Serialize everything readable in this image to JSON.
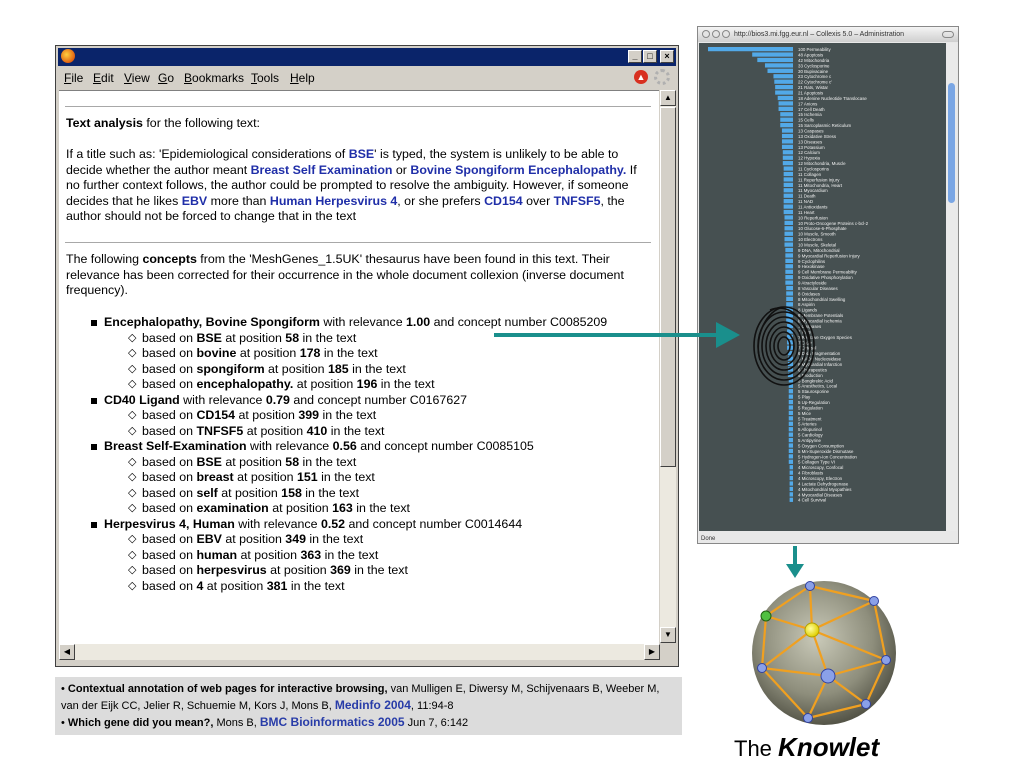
{
  "menu": [
    "File",
    "Edit",
    "View",
    "Go",
    "Bookmarks",
    "Tools",
    "Help"
  ],
  "window_buttons": [
    "_",
    "□",
    "×"
  ],
  "intro": {
    "heading_bold": "Text analysis",
    "heading_rest": " for the following text:",
    "p1": "If a title such as: 'Epidemiological considerations of ",
    "p1_bse": "BSE",
    "p2": "' is typed, the system is unlikely to be able to decide whether the author meant ",
    "p2_bse_long": "Breast Self Examination",
    "p3": " or ",
    "p3_bovine": "Bovine Spongiform Encephalopathy.",
    "p4": " If no further context follows, the author could be prompted to resolve the ambiguity. However, if someone decides that he likes ",
    "p4_ebv": "EBV",
    "p5": " more than ",
    "p5_herpes": "Human Herpesvirus 4",
    "p6": ", or she prefers ",
    "p6_cd154": "CD154",
    "p7": " over ",
    "p7_tnfsf5": "TNFSF5",
    "p8": ", the author should not be forced to change that in the text"
  },
  "concepts_intro": {
    "a": "The following ",
    "b": "concepts",
    "c": " from the 'MeshGenes_1.5UK' thesaurus have been found in this text. Their relevance has been corrected for their occurrence in the whole document collexion (inverse document frequency)."
  },
  "concepts": [
    {
      "name": "Encephalopathy, Bovine Spongiform",
      "relevance": "1.00",
      "number": "C0085209",
      "evidence": [
        {
          "term": "BSE",
          "position": "58"
        },
        {
          "term": "bovine",
          "position": "178"
        },
        {
          "term": "spongiform",
          "position": "185"
        },
        {
          "term": "encephalopathy.",
          "position": "196"
        }
      ]
    },
    {
      "name": "CD40 Ligand",
      "relevance": "0.79",
      "number": "C0167627",
      "evidence": [
        {
          "term": "CD154",
          "position": "399"
        },
        {
          "term": "TNFSF5",
          "position": "410"
        }
      ]
    },
    {
      "name": "Breast Self-Examination",
      "relevance": "0.56",
      "number": "C0085105",
      "evidence": [
        {
          "term": "BSE",
          "position": "58"
        },
        {
          "term": "breast",
          "position": "151"
        },
        {
          "term": "self",
          "position": "158"
        },
        {
          "term": "examination",
          "position": "163"
        }
      ]
    },
    {
      "name": "Herpesvirus 4, Human",
      "relevance": "0.52",
      "number": "C0014644",
      "evidence": [
        {
          "term": "EBV",
          "position": "349"
        },
        {
          "term": "human",
          "position": "363"
        },
        {
          "term": "herpesvirus",
          "position": "369"
        },
        {
          "term": "4",
          "position": "381"
        }
      ]
    }
  ],
  "phrases": {
    "with_relevance": " with relevance ",
    "and_concept": " and concept number ",
    "based_on": "based on ",
    "at_position": " at position ",
    "in_text": " in the text"
  },
  "references": {
    "r1_title": "Contextual annotation of web pages for interactive browsing,",
    "r1_authors": " van Mulligen E, Diwersy M, Schijvenaars B, Weeber M, van der Eijk CC, Jelier R, Schuemie M, Kors J, Mons B, ",
    "r1_venue": "Medinfo 2004",
    "r1_pages": ", 11:94-8",
    "r2_title": "Which gene did you mean?,",
    "r2_authors": " Mons B, ",
    "r2_venue": "BMC Bioinformatics 2005",
    "r2_pages": " Jun 7, 6:142"
  },
  "collexis": {
    "title": "http://bios3.mi.fgg.eur.nl – Collexis 5.0 – Administration",
    "status": "Done",
    "items": [
      {
        "v": 100,
        "label": "Permeability"
      },
      {
        "v": 48,
        "label": "Apoptosis"
      },
      {
        "v": 42,
        "label": "Mitochondria"
      },
      {
        "v": 33,
        "label": "Cyclosporine"
      },
      {
        "v": 30,
        "label": "Bupivacaine"
      },
      {
        "v": 23,
        "label": "Cytochrome c"
      },
      {
        "v": 22,
        "label": "Cytochrome c'"
      },
      {
        "v": 21,
        "label": "Rats, Wistar"
      },
      {
        "v": 21,
        "label": "Apoptosis"
      },
      {
        "v": 18,
        "label": "Adenine Nucleotide Translocase"
      },
      {
        "v": 17,
        "label": "Anions"
      },
      {
        "v": 17,
        "label": "Cell Death"
      },
      {
        "v": 15,
        "label": "Ischemia"
      },
      {
        "v": 15,
        "label": "Cells"
      },
      {
        "v": 15,
        "label": "Sarcoplasmic Reticulum"
      },
      {
        "v": 13,
        "label": "Caspases"
      },
      {
        "v": 13,
        "label": "Oxidative Stress"
      },
      {
        "v": 13,
        "label": "Diseases"
      },
      {
        "v": 13,
        "label": "Potassium"
      },
      {
        "v": 12,
        "label": "Calcium"
      },
      {
        "v": 12,
        "label": "Hypoxia"
      },
      {
        "v": 12,
        "label": "Mitochondria, Muscle"
      },
      {
        "v": 11,
        "label": "Cyclosporins"
      },
      {
        "v": 11,
        "label": "Collagen"
      },
      {
        "v": 11,
        "label": "Reperfusion Injury"
      },
      {
        "v": 11,
        "label": "Mitochondria, Heart"
      },
      {
        "v": 11,
        "label": "Myocardium"
      },
      {
        "v": 11,
        "label": "Death"
      },
      {
        "v": 11,
        "label": "NAD"
      },
      {
        "v": 11,
        "label": "Antioxidants"
      },
      {
        "v": 11,
        "label": "Heart"
      },
      {
        "v": 10,
        "label": "Reperfusion"
      },
      {
        "v": 10,
        "label": "Proto-Oncogene Proteins c-bcl-2"
      },
      {
        "v": 10,
        "label": "Glucose-6-Phosphate"
      },
      {
        "v": 10,
        "label": "Muscle, Smooth"
      },
      {
        "v": 10,
        "label": "Electrons"
      },
      {
        "v": 10,
        "label": "Muscle, Skeletal"
      },
      {
        "v": 9,
        "label": "DNA, Mitochondrial"
      },
      {
        "v": 9,
        "label": "Myocardial Reperfusion Injury"
      },
      {
        "v": 9,
        "label": "Cyclophilins"
      },
      {
        "v": 9,
        "label": "Hexokinase"
      },
      {
        "v": 9,
        "label": "Cell Membrane Permeability"
      },
      {
        "v": 9,
        "label": "Oxidative Phosphorylation"
      },
      {
        "v": 9,
        "label": "Atractyloside"
      },
      {
        "v": 8,
        "label": "Vascular Diseases"
      },
      {
        "v": 8,
        "label": "Oxidases"
      },
      {
        "v": 8,
        "label": "Mitochondrial Swelling"
      },
      {
        "v": 8,
        "label": "Aspirin"
      },
      {
        "v": 8,
        "label": "Ligands"
      },
      {
        "v": 8,
        "label": "Membrane Potentials"
      },
      {
        "v": 8,
        "label": "Myocardial Ischemia"
      },
      {
        "v": 7,
        "label": "Caspases"
      },
      {
        "v": 7,
        "label": "Rats"
      },
      {
        "v": 7,
        "label": "Reactive Oxygen Species"
      },
      {
        "v": 7,
        "label": "Ca2+"
      },
      {
        "v": 7,
        "label": "Cytosol"
      },
      {
        "v": 6,
        "label": "DNA Fragmentation"
      },
      {
        "v": 6,
        "label": "NAD+ Nucleosidase"
      },
      {
        "v": 6,
        "label": "Myocardial Infarction"
      },
      {
        "v": 6,
        "label": "Therapeutics"
      },
      {
        "v": 6,
        "label": "Production"
      },
      {
        "v": 5,
        "label": "Bongkrekic Acid"
      },
      {
        "v": 5,
        "label": "Anesthetics, Local"
      },
      {
        "v": 5,
        "label": "Staurosporine"
      },
      {
        "v": 5,
        "label": "Play"
      },
      {
        "v": 5,
        "label": "Up-Regulation"
      },
      {
        "v": 5,
        "label": "Regulation"
      },
      {
        "v": 5,
        "label": "Mice"
      },
      {
        "v": 5,
        "label": "Treatment"
      },
      {
        "v": 5,
        "label": "Arteries"
      },
      {
        "v": 5,
        "label": "Allopurinol"
      },
      {
        "v": 5,
        "label": "Cardiology"
      },
      {
        "v": 5,
        "label": "Antipyrine"
      },
      {
        "v": 5,
        "label": "Oxygen Consumption"
      },
      {
        "v": 5,
        "label": "Mn-Superoxide Dismutase"
      },
      {
        "v": 5,
        "label": "Hydrogen-Ion Concentration"
      },
      {
        "v": 5,
        "label": "Collagen Type VI"
      },
      {
        "v": 4,
        "label": "Microscopy, Confocal"
      },
      {
        "v": 4,
        "label": "Fibroblasts"
      },
      {
        "v": 4,
        "label": "Microscopy, Electron"
      },
      {
        "v": 4,
        "label": "Lactate Dehydrogenase"
      },
      {
        "v": 4,
        "label": "Mitochondrial Myopathies"
      },
      {
        "v": 4,
        "label": "Myocardial Diseases"
      },
      {
        "v": 4,
        "label": "Cell Survival"
      }
    ]
  },
  "knowlet": {
    "the": "The",
    "name": "Knowlet"
  },
  "colors": {
    "link_blue": "#1f2ea8",
    "arrow_teal": "#1a8f8c",
    "bar_blue": "#52a9e8",
    "sphere": "#8e8e7c",
    "edge_orange": "#f0a020"
  },
  "icons": [
    "firefox-logo-icon",
    "stop-icon",
    "throbber-icon",
    "fingerprint-icon",
    "scroll-up-arrow-icon",
    "scroll-down-arrow-icon"
  ]
}
